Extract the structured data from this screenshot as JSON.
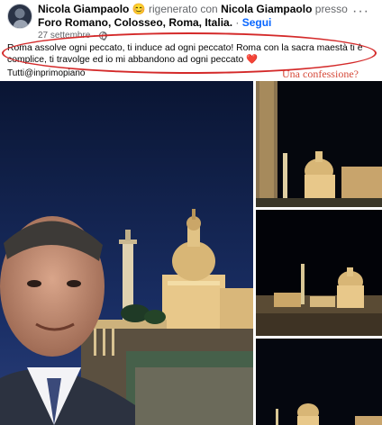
{
  "post": {
    "author": "Nicola Giampaolo",
    "emoji": "😊",
    "action": "rigenerato con",
    "tagged": "Nicola Giampaolo",
    "preposition": "presso",
    "place": "Foro Romano, Colosseo, Roma, Italia.",
    "separator": "·",
    "follow_label": "Segui",
    "date": "27 settembre",
    "caption": "Roma assolve ogni peccato, ti induce ad ogni peccato! Roma con la sacra maestà ti è complice, ti travolge ed io mi abbandono ad ogni peccato",
    "heart": "❤️",
    "hashtag": "Tutti@inprimopiano",
    "annotation_label": "Una confessione?"
  },
  "icons": {
    "more": "more-options-icon",
    "audience": "globe-icon",
    "avatar": "profile-avatar"
  },
  "colors": {
    "accent": "#0866ff",
    "annotation": "#d42a2a",
    "night_sky": "#0d1a3a",
    "monument_light": "#e8c88a"
  }
}
